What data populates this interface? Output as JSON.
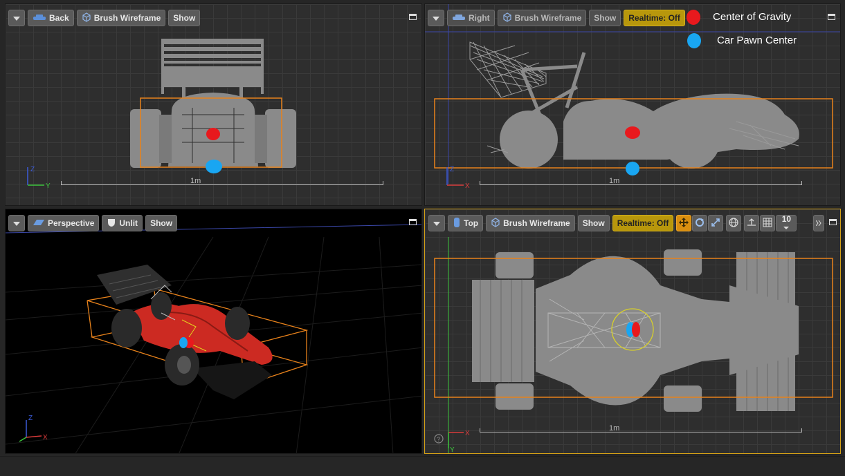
{
  "viewports": {
    "back": {
      "view_label": "Back",
      "mode_label": "Brush Wireframe",
      "show_label": "Show",
      "scale_label": "1m",
      "axes": [
        "Z",
        "Y"
      ]
    },
    "right": {
      "view_label": "Right",
      "mode_label": "Brush Wireframe",
      "show_label": "Show",
      "realtime_label": "Realtime: Off",
      "scale_label": "1m",
      "axes": [
        "Z",
        "X"
      ]
    },
    "perspective": {
      "view_label": "Perspective",
      "mode_label": "Unlit",
      "show_label": "Show",
      "axes": [
        "Z",
        "X"
      ]
    },
    "top": {
      "view_label": "Top",
      "mode_label": "Brush Wireframe",
      "show_label": "Show",
      "realtime_label": "Realtime: Off",
      "grid_snap_value": "10",
      "scale_label": "1m",
      "axes": [
        "X",
        "Y"
      ]
    }
  },
  "legend": {
    "center_of_gravity": "Center of Gravity",
    "car_pawn_center": "Car Pawn Center"
  },
  "colors": {
    "center_of_gravity": "#e8191d",
    "car_pawn_center": "#19a6f2",
    "bounds": "#e8821b",
    "mesh": "#8a8a8a",
    "realtime_button": "#b8970c",
    "active_border": "#d4a017"
  }
}
